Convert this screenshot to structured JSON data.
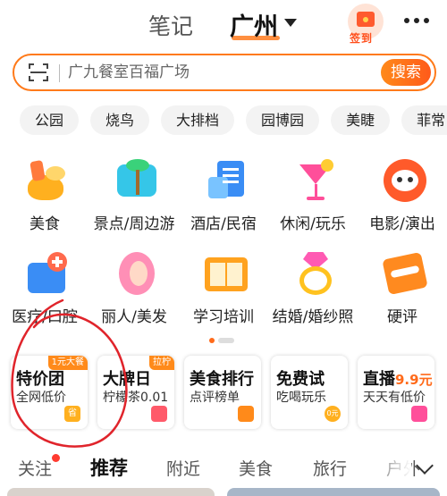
{
  "header": {
    "tab_notes": "笔记",
    "tab_city": "广州",
    "signin_label": "签到"
  },
  "search": {
    "placeholder": "广九餐室百福广场",
    "button_label": "搜索"
  },
  "chips": [
    "公园",
    "烧鸟",
    "大排档",
    "园博园",
    "美睫",
    "菲常"
  ],
  "categories": [
    {
      "label": "美食",
      "icon": "food-icon"
    },
    {
      "label": "景点/周边游",
      "icon": "scenic-icon"
    },
    {
      "label": "酒店/民宿",
      "icon": "hotel-icon"
    },
    {
      "label": "休闲/玩乐",
      "icon": "cocktail-icon"
    },
    {
      "label": "电影/演出",
      "icon": "movie-icon"
    },
    {
      "label": "医疗/口腔",
      "icon": "medical-icon"
    },
    {
      "label": "丽人/美发",
      "icon": "beauty-icon"
    },
    {
      "label": "学习培训",
      "icon": "book-icon"
    },
    {
      "label": "结婚/婚纱照",
      "icon": "ring-icon"
    },
    {
      "label": "硬评",
      "icon": "review-icon"
    }
  ],
  "promos": [
    {
      "title": "特价团",
      "subtitle": "全网低价",
      "tag": "1元大餐",
      "badge": "省"
    },
    {
      "title": "大牌日",
      "subtitle": "柠檬茶0.01",
      "tag": "拉柠",
      "badge": ""
    },
    {
      "title": "美食排行",
      "subtitle": "点评榜单",
      "tag": "",
      "badge": ""
    },
    {
      "title": "免费试",
      "subtitle": "吃喝玩乐",
      "tag": "",
      "badge": "0元"
    },
    {
      "title": "直播",
      "title_accent": "9.9元",
      "subtitle": "天天有低价",
      "tag": "",
      "badge": ""
    }
  ],
  "feed_tabs": [
    "关注",
    "推荐",
    "附近",
    "美食",
    "旅行",
    "户外"
  ],
  "colors": {
    "accent": "#ff6a1a",
    "annotation": "#e0242b"
  }
}
